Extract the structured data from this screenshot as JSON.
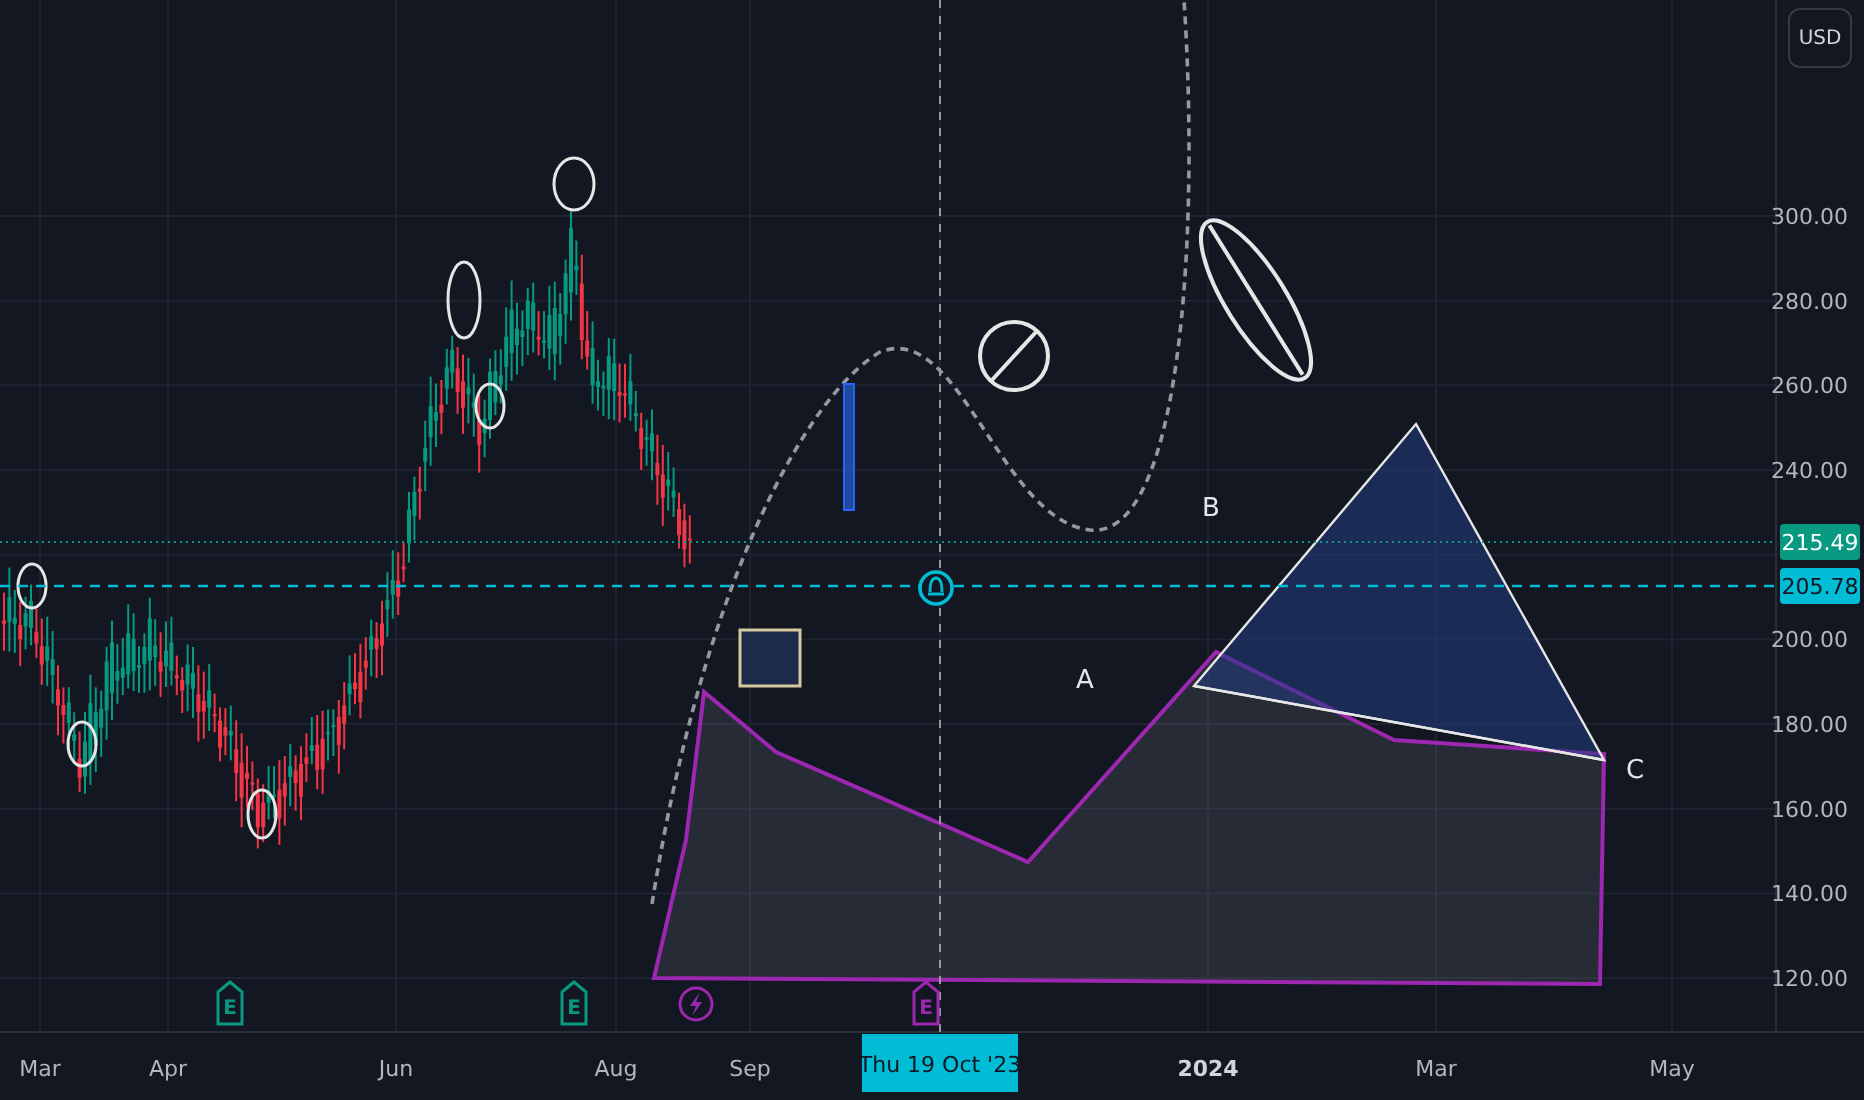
{
  "currency_button": "USD",
  "price_axis": {
    "ticks": [
      "300.00",
      "280.00",
      "260.00",
      "240.00",
      "200.00",
      "180.00",
      "160.00",
      "140.00",
      "120.00"
    ]
  },
  "price_labels": [
    {
      "text": "215.49",
      "color": "#089981"
    },
    {
      "text": "205.78",
      "color": "#00bcd4"
    }
  ],
  "time_axis": {
    "labels": [
      {
        "text": "Mar",
        "bold": false
      },
      {
        "text": "Apr",
        "bold": false
      },
      {
        "text": "Jun",
        "bold": false
      },
      {
        "text": "Aug",
        "bold": false
      },
      {
        "text": "Sep",
        "bold": false
      },
      {
        "text": "2024",
        "bold": true
      },
      {
        "text": "Mar",
        "bold": false
      },
      {
        "text": "May",
        "bold": false
      }
    ]
  },
  "crosshair": {
    "date": "Thu 19 Oct '23"
  },
  "drawing_labels": [
    "A",
    "B",
    "C"
  ],
  "events": [
    {
      "kind": "earnings",
      "text": "E",
      "color": "#089981"
    },
    {
      "kind": "earnings",
      "text": "E",
      "color": "#089981"
    },
    {
      "kind": "news",
      "color": "#9c27b0"
    },
    {
      "kind": "earnings",
      "text": "E",
      "color": "#9c27b0"
    }
  ]
}
